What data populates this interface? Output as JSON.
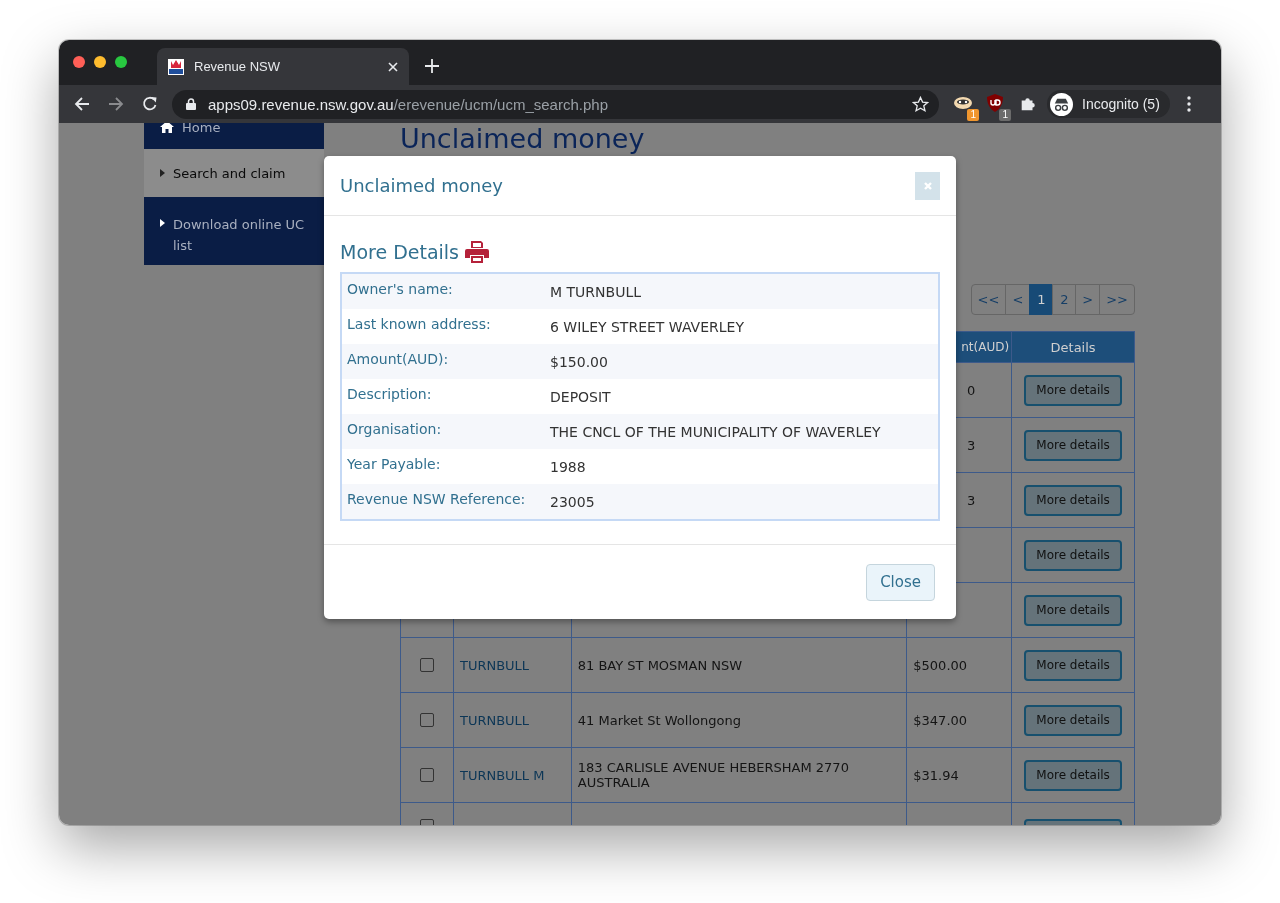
{
  "browser": {
    "tab_title": "Revenue NSW",
    "url_host": "apps09.revenue.nsw.gov.au",
    "url_path": "/erevenue/ucm/ucm_search.php",
    "extensions": [
      {
        "kind": "mascot",
        "badge": "1",
        "color": "#f0962e"
      },
      {
        "kind": "shield",
        "badge": "1",
        "color": "#6b6b6b"
      }
    ],
    "profile": "Incognito (5)"
  },
  "sidebar": {
    "items": [
      {
        "kind": "home",
        "label": "Home",
        "selected": false
      },
      {
        "kind": "link",
        "label": "Search and claim",
        "selected": true
      },
      {
        "kind": "link",
        "label": "Download online UC list",
        "selected": false
      }
    ]
  },
  "page_title": "Unclaimed money",
  "pagination": [
    {
      "label": "<<",
      "selected": false
    },
    {
      "label": "<",
      "selected": false
    },
    {
      "label": "1",
      "selected": true
    },
    {
      "label": "2",
      "selected": false
    },
    {
      "label": ">",
      "selected": false
    },
    {
      "label": ">>",
      "selected": false
    }
  ],
  "table": {
    "columns": [
      "nt(AUD)",
      "Details"
    ],
    "rows": [
      {
        "kind": "covered",
        "amount": "0",
        "button": "More details"
      },
      {
        "kind": "covered",
        "amount": "3",
        "button": "More details"
      },
      {
        "kind": "covered",
        "amount": "3",
        "button": "More details"
      },
      {
        "kind": "covered",
        "button": "More details"
      },
      {
        "kind": "covered",
        "button": "More details"
      },
      {
        "kind": "full",
        "checked": false,
        "name": "TURNBULL",
        "address": "81 BAY ST MOSMAN NSW",
        "amount": "$500.00",
        "button": "More details"
      },
      {
        "kind": "full",
        "checked": false,
        "name": "TURNBULL",
        "address": "41 Market St Wollongong",
        "amount": "$347.00",
        "button": "More details"
      },
      {
        "kind": "full",
        "checked": false,
        "name": "TURNBULL M",
        "address": "183 CARLISLE AVENUE HEBERSHAM 2770 AUSTRALIA",
        "amount": "$31.94",
        "button": "More details"
      },
      {
        "kind": "cut",
        "checked": false
      }
    ]
  },
  "modal": {
    "title": "Unclaimed money",
    "heading": "More Details",
    "details": [
      {
        "label": "Owner's name:",
        "value": "M TURNBULL"
      },
      {
        "label": "Last known address:",
        "value": "6 WILEY STREET WAVERLEY"
      },
      {
        "label": "Amount(AUD):",
        "value": "$150.00"
      },
      {
        "label": "Description:",
        "value": "DEPOSIT"
      },
      {
        "label": "Organisation:",
        "value": "THE CNCL OF THE MUNICIPALITY OF WAVERLEY"
      },
      {
        "label": "Year Payable:",
        "value": "1988"
      },
      {
        "label": "Revenue NSW Reference:",
        "value": "23005"
      }
    ],
    "close_button": "Close"
  }
}
